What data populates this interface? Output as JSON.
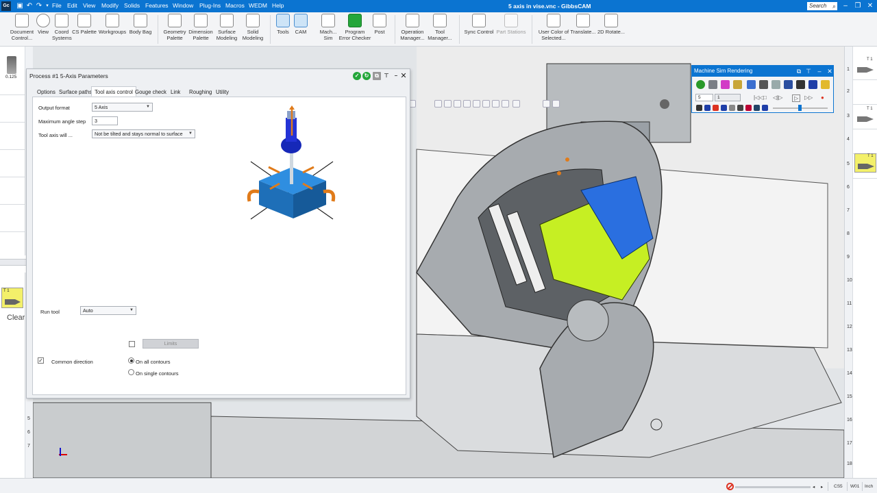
{
  "app": {
    "window_title": "5 axis in vise.vnc - GibbsCAM",
    "logo_text": "Gc",
    "search_placeholder": "Search"
  },
  "menu": [
    "File",
    "Edit",
    "View",
    "Modify",
    "Solids",
    "Features",
    "Window",
    "Plug-Ins",
    "Macros",
    "WEDM",
    "Help"
  ],
  "ribbon": [
    {
      "label": "Document\nControl...",
      "icon": "document-icon"
    },
    {
      "label": "View",
      "icon": "view-icon"
    },
    {
      "label": "Coord\nSystems",
      "icon": "coord-systems-icon"
    },
    {
      "label": "CS Palette",
      "icon": "cs-palette-icon"
    },
    {
      "label": "Workgroups",
      "icon": "workgroups-icon"
    },
    {
      "label": "Body Bag",
      "icon": "body-bag-icon"
    },
    {
      "label": "Geometry\nPalette",
      "icon": "geometry-palette-icon"
    },
    {
      "label": "Dimension\nPalette",
      "icon": "dimension-palette-icon"
    },
    {
      "label": "Surface\nModeling",
      "icon": "surface-modeling-icon"
    },
    {
      "label": "Solid\nModeling",
      "icon": "solid-modeling-icon"
    },
    {
      "label": "Tools",
      "icon": "tools-icon",
      "active": true
    },
    {
      "label": "CAM",
      "icon": "cam-icon",
      "active": true
    },
    {
      "label": "Mach...\nSim",
      "icon": "machine-sim-icon"
    },
    {
      "label": "Program\nError Checker",
      "icon": "program-checker-icon"
    },
    {
      "label": "Post",
      "icon": "post-icon"
    },
    {
      "label": "Operation\nManager...",
      "icon": "operation-manager-icon"
    },
    {
      "label": "Tool\nManager...",
      "icon": "tool-manager-icon"
    },
    {
      "label": "Sync Control",
      "icon": "sync-control-icon"
    },
    {
      "label": "Part Stations",
      "icon": "part-stations-icon",
      "disabled": true
    },
    {
      "label": "User Color of\nSelected...",
      "icon": "user-color-icon"
    },
    {
      "label": "Translate...",
      "icon": "translate-icon"
    },
    {
      "label": "2D Rotate...",
      "icon": "rotate-2d-icon"
    }
  ],
  "left_panel": {
    "tool_size": "0.125",
    "clear_label": "Clear",
    "tool_tag": "T 1",
    "tool_num": "1",
    "numbers": [
      "5",
      "6",
      "7"
    ]
  },
  "dialog": {
    "title": "Process #1 5-Axis Parameters",
    "tabs": [
      "Options",
      "Surface paths",
      "Tool axis control",
      "Gouge check",
      "Link",
      "Roughing",
      "Utility"
    ],
    "active_tab": "Tool axis control",
    "output_format_label": "Output format",
    "output_format_value": "5 Axis",
    "max_angle_label": "Maximum angle step",
    "max_angle_value": "3",
    "tool_axis_label": "Tool axis will ...",
    "tool_axis_value": "Not be tilted and stays normal to surface",
    "run_tool_label": "Run tool",
    "run_tool_value": "Auto",
    "limits_label": "Limits",
    "limits_checked": false,
    "common_direction_label": "Common direction",
    "common_direction_checked": true,
    "radio_all": "On all contours",
    "radio_single": "On single contours",
    "radio_selected": "all"
  },
  "sim_panel": {
    "title": "Machine Sim Rendering",
    "step_value": "5",
    "step_value2": "1"
  },
  "right_panel": {
    "numbers": [
      "1",
      "2",
      "3",
      "4",
      "5",
      "6",
      "7",
      "8",
      "9",
      "10",
      "11",
      "12",
      "13",
      "14",
      "15",
      "16",
      "17",
      "18"
    ],
    "tool_tags": [
      "T 1",
      "T 1",
      "T 1"
    ]
  },
  "status": {
    "units": "Inch",
    "wcs": "W01",
    "cs": "CS5"
  },
  "colors": {
    "title_blue": "#0b74d1",
    "part_green": "#c6ef23",
    "fixture_blue": "#2a6fe0",
    "machine_grey": "#9aa0a6"
  }
}
